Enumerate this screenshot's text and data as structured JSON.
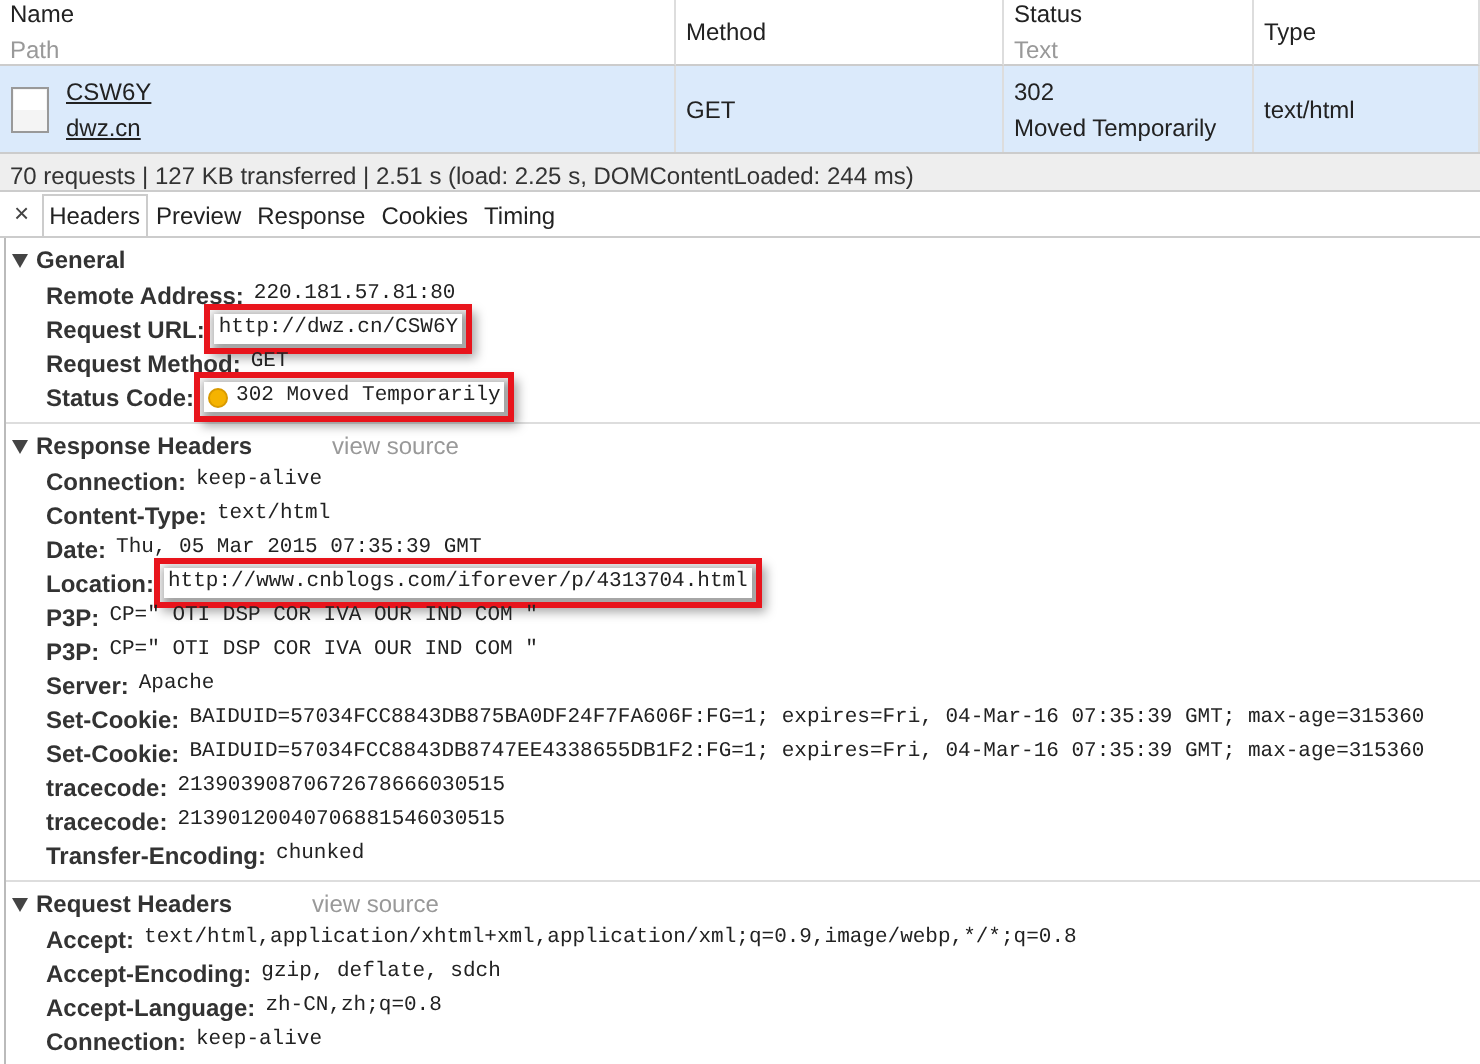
{
  "table": {
    "columns": [
      {
        "title": "Name",
        "subtitle": "Path"
      },
      {
        "title": "Method"
      },
      {
        "title": "Status",
        "subtitle": "Text"
      },
      {
        "title": "Type"
      }
    ],
    "rows": [
      {
        "name": "CSW6Y",
        "path": "dwz.cn",
        "method": "GET",
        "status": "302",
        "status_text": "Moved Temporarily",
        "type": "text/html",
        "selected": true
      }
    ]
  },
  "summary": "70 requests | 127 KB transferred | 2.51 s (load: 2.25 s, DOMContentLoaded: 244 ms)",
  "close": "×",
  "tabs": [
    {
      "label": "Headers",
      "selected": true
    },
    {
      "label": "Preview",
      "selected": false
    },
    {
      "label": "Response",
      "selected": false
    },
    {
      "label": "Cookies",
      "selected": false
    },
    {
      "label": "Timing",
      "selected": false
    }
  ],
  "sections": [
    {
      "title": "General",
      "expanded": true,
      "headers": [
        {
          "name": "Remote Address:",
          "value": "220.181.57.81:80",
          "highlighted": false
        },
        {
          "name": "Request URL:",
          "value": "http://dwz.cn/CSW6Y",
          "highlighted": true
        },
        {
          "name": "Request Method:",
          "value": "GET",
          "highlighted": false
        },
        {
          "name": "Status Code:",
          "value": "302 Moved Temporarily",
          "highlighted": true,
          "kind": "status"
        }
      ]
    },
    {
      "title": "Response Headers",
      "link": "view source",
      "expanded": true,
      "headers": [
        {
          "name": "Connection:",
          "value": "keep-alive",
          "highlighted": false
        },
        {
          "name": "Content-Type:",
          "value": "text/html",
          "highlighted": false
        },
        {
          "name": "Date:",
          "value": "Thu, 05 Mar 2015 07:35:39 GMT",
          "highlighted": false
        },
        {
          "name": "Location:",
          "value": "http://www.cnblogs.com/iforever/p/4313704.html",
          "highlighted": true
        },
        {
          "name": "P3P:",
          "value": "CP=\" OTI DSP COR IVA OUR IND COM \"",
          "highlighted": false
        },
        {
          "name": "P3P:",
          "value": "CP=\" OTI DSP COR IVA OUR IND COM \"",
          "highlighted": false
        },
        {
          "name": "Server:",
          "value": "Apache",
          "highlighted": false
        },
        {
          "name": "Set-Cookie:",
          "value": "BAIDUID=57034FCC8843DB875BA0DF24F7FA606F:FG=1; expires=Fri, 04-Mar-16 07:35:39 GMT; max-age=315360",
          "highlighted": false
        },
        {
          "name": "Set-Cookie:",
          "value": "BAIDUID=57034FCC8843DB8747EE4338655DB1F2:FG=1; expires=Fri, 04-Mar-16 07:35:39 GMT; max-age=315360",
          "highlighted": false
        },
        {
          "name": "tracecode:",
          "value": "21390390870672678666030515",
          "highlighted": false
        },
        {
          "name": "tracecode:",
          "value": "21390120040706881546030515",
          "highlighted": false
        },
        {
          "name": "Transfer-Encoding:",
          "value": "chunked",
          "highlighted": false
        }
      ]
    },
    {
      "title": "Request Headers",
      "link": "view source",
      "expanded": true,
      "headers": [
        {
          "name": "Accept:",
          "value": "text/html,application/xhtml+xml,application/xml;q=0.9,image/webp,*/*;q=0.8",
          "highlighted": false
        },
        {
          "name": "Accept-Encoding:",
          "value": "gzip, deflate, sdch",
          "highlighted": false
        },
        {
          "name": "Accept-Language:",
          "value": "zh-CN,zh;q=0.8",
          "highlighted": false
        },
        {
          "name": "Connection:",
          "value": "keep-alive",
          "highlighted": false
        }
      ]
    }
  ]
}
